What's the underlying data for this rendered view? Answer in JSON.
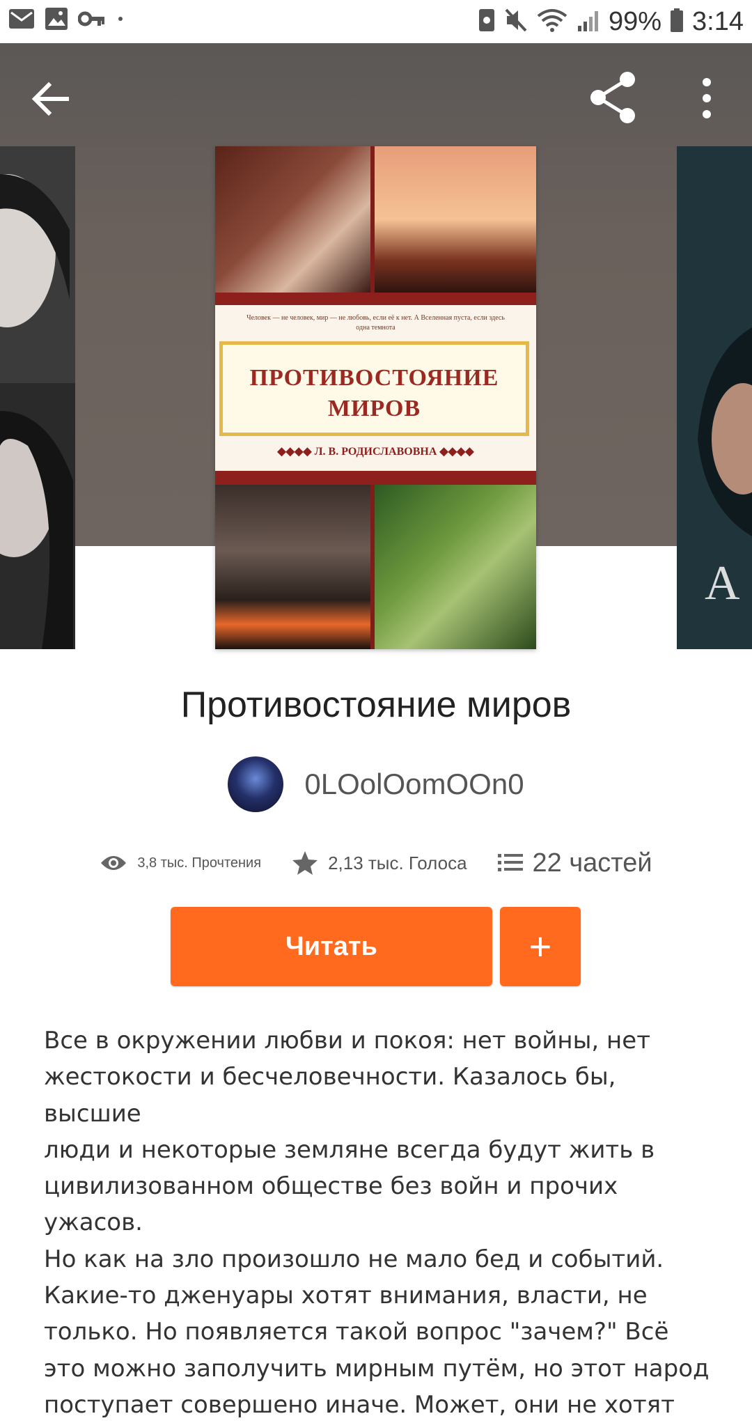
{
  "status_bar": {
    "battery": "99%",
    "time": "3:14",
    "left_icons": [
      "mail-icon",
      "image-icon",
      "key-icon",
      "dot-icon"
    ],
    "right_icons": [
      "nfc-icon",
      "mute-icon",
      "wifi-icon",
      "signal-icon",
      "battery-icon"
    ]
  },
  "header": {
    "icons": [
      "back-arrow-icon",
      "share-icon",
      "more-vert-icon"
    ]
  },
  "cover": {
    "tagline": "Человек — не человек, мир — не любовь, если её к нет. А Вселенная пуста, если здесь одна темнота",
    "title_line1": "ПРОТИВОСТОЯНИЕ",
    "title_line2": "МИРОВ",
    "author": "◆◆◆◆ Л. В. РОДИСЛАВОВНА ◆◆◆◆"
  },
  "book": {
    "title": "Противостояние миров",
    "author": "0LOolOomOOn0"
  },
  "stats": {
    "reads": "3,8 тыс. Прочтения",
    "votes": "2,13 тыс. Голоса",
    "parts": "22 частей"
  },
  "actions": {
    "read_label": "Читать",
    "add_label": "+"
  },
  "description": "Все в окружении любви и покоя: нет войны, нет\nжестокости и бесчеловечности. Казалось бы, высшие\nлюди и некоторые земляне всегда будут жить в\nцивилизованном обществе без войн и прочих ужасов.\nНо как на зло произошло не мало бед и событий.\nКакие-то дженуары хотят внимания, власти, не\nтолько. Но появляется такой вопрос \"зачем?\" Всё\nэто можно заполучить мирным путём, но этот народ\nпоступает совершено иначе. Может, они не хотят",
  "colors": {
    "accent": "#ff6a1f",
    "hero_bg": "#655e5a"
  }
}
